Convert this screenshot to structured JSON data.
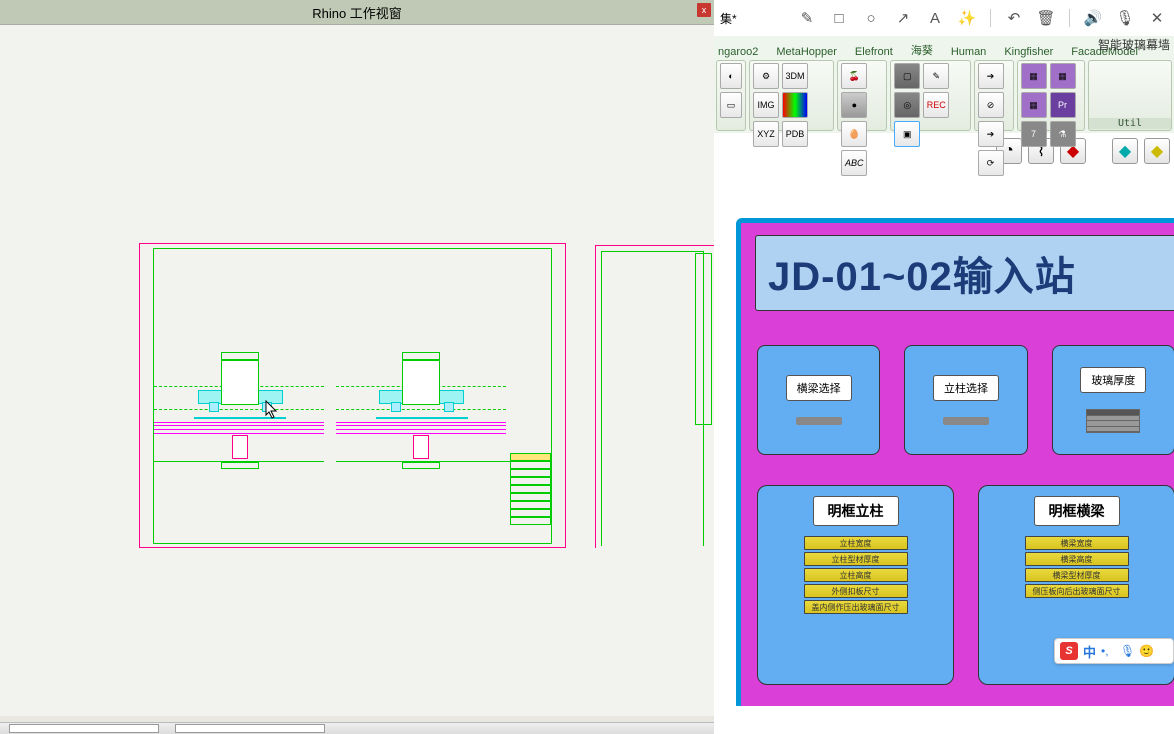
{
  "rhino": {
    "title": "Rhino 工作视窗",
    "close": "x"
  },
  "doc_suffix": "集*",
  "subtitle_right": "智能玻璃幕墙",
  "top_icons": [
    "✎",
    "□",
    "○",
    "↗",
    "A",
    "✨",
    "↶",
    "🗑",
    "🔊",
    "🎙",
    "✕"
  ],
  "tabs": [
    "ngaroo2",
    "MetaHopper",
    "Elefront",
    "海葵",
    "Human",
    "Kingfisher",
    "FacadeModel"
  ],
  "util_label": "Util",
  "gh": {
    "title": "JD-01~02输入站",
    "params": [
      {
        "label": "横梁选择",
        "kind": "slider"
      },
      {
        "label": "立柱选择",
        "kind": "slider"
      },
      {
        "label": "玻璃厚度",
        "kind": "list"
      }
    ],
    "sections": [
      {
        "title": "明框立柱",
        "strips": [
          "立柱宽度",
          "立柱型材厚度",
          "立柱高度",
          "外侧扣板尺寸",
          "盖内侧作压出玻璃面尺寸"
        ]
      },
      {
        "title": "明框横梁",
        "strips": [
          "横梁宽度",
          "横梁高度",
          "横梁型材厚度",
          "侧压板向后出玻璃面尺寸"
        ]
      }
    ]
  },
  "ime": {
    "logo": "S",
    "lang": "中"
  }
}
